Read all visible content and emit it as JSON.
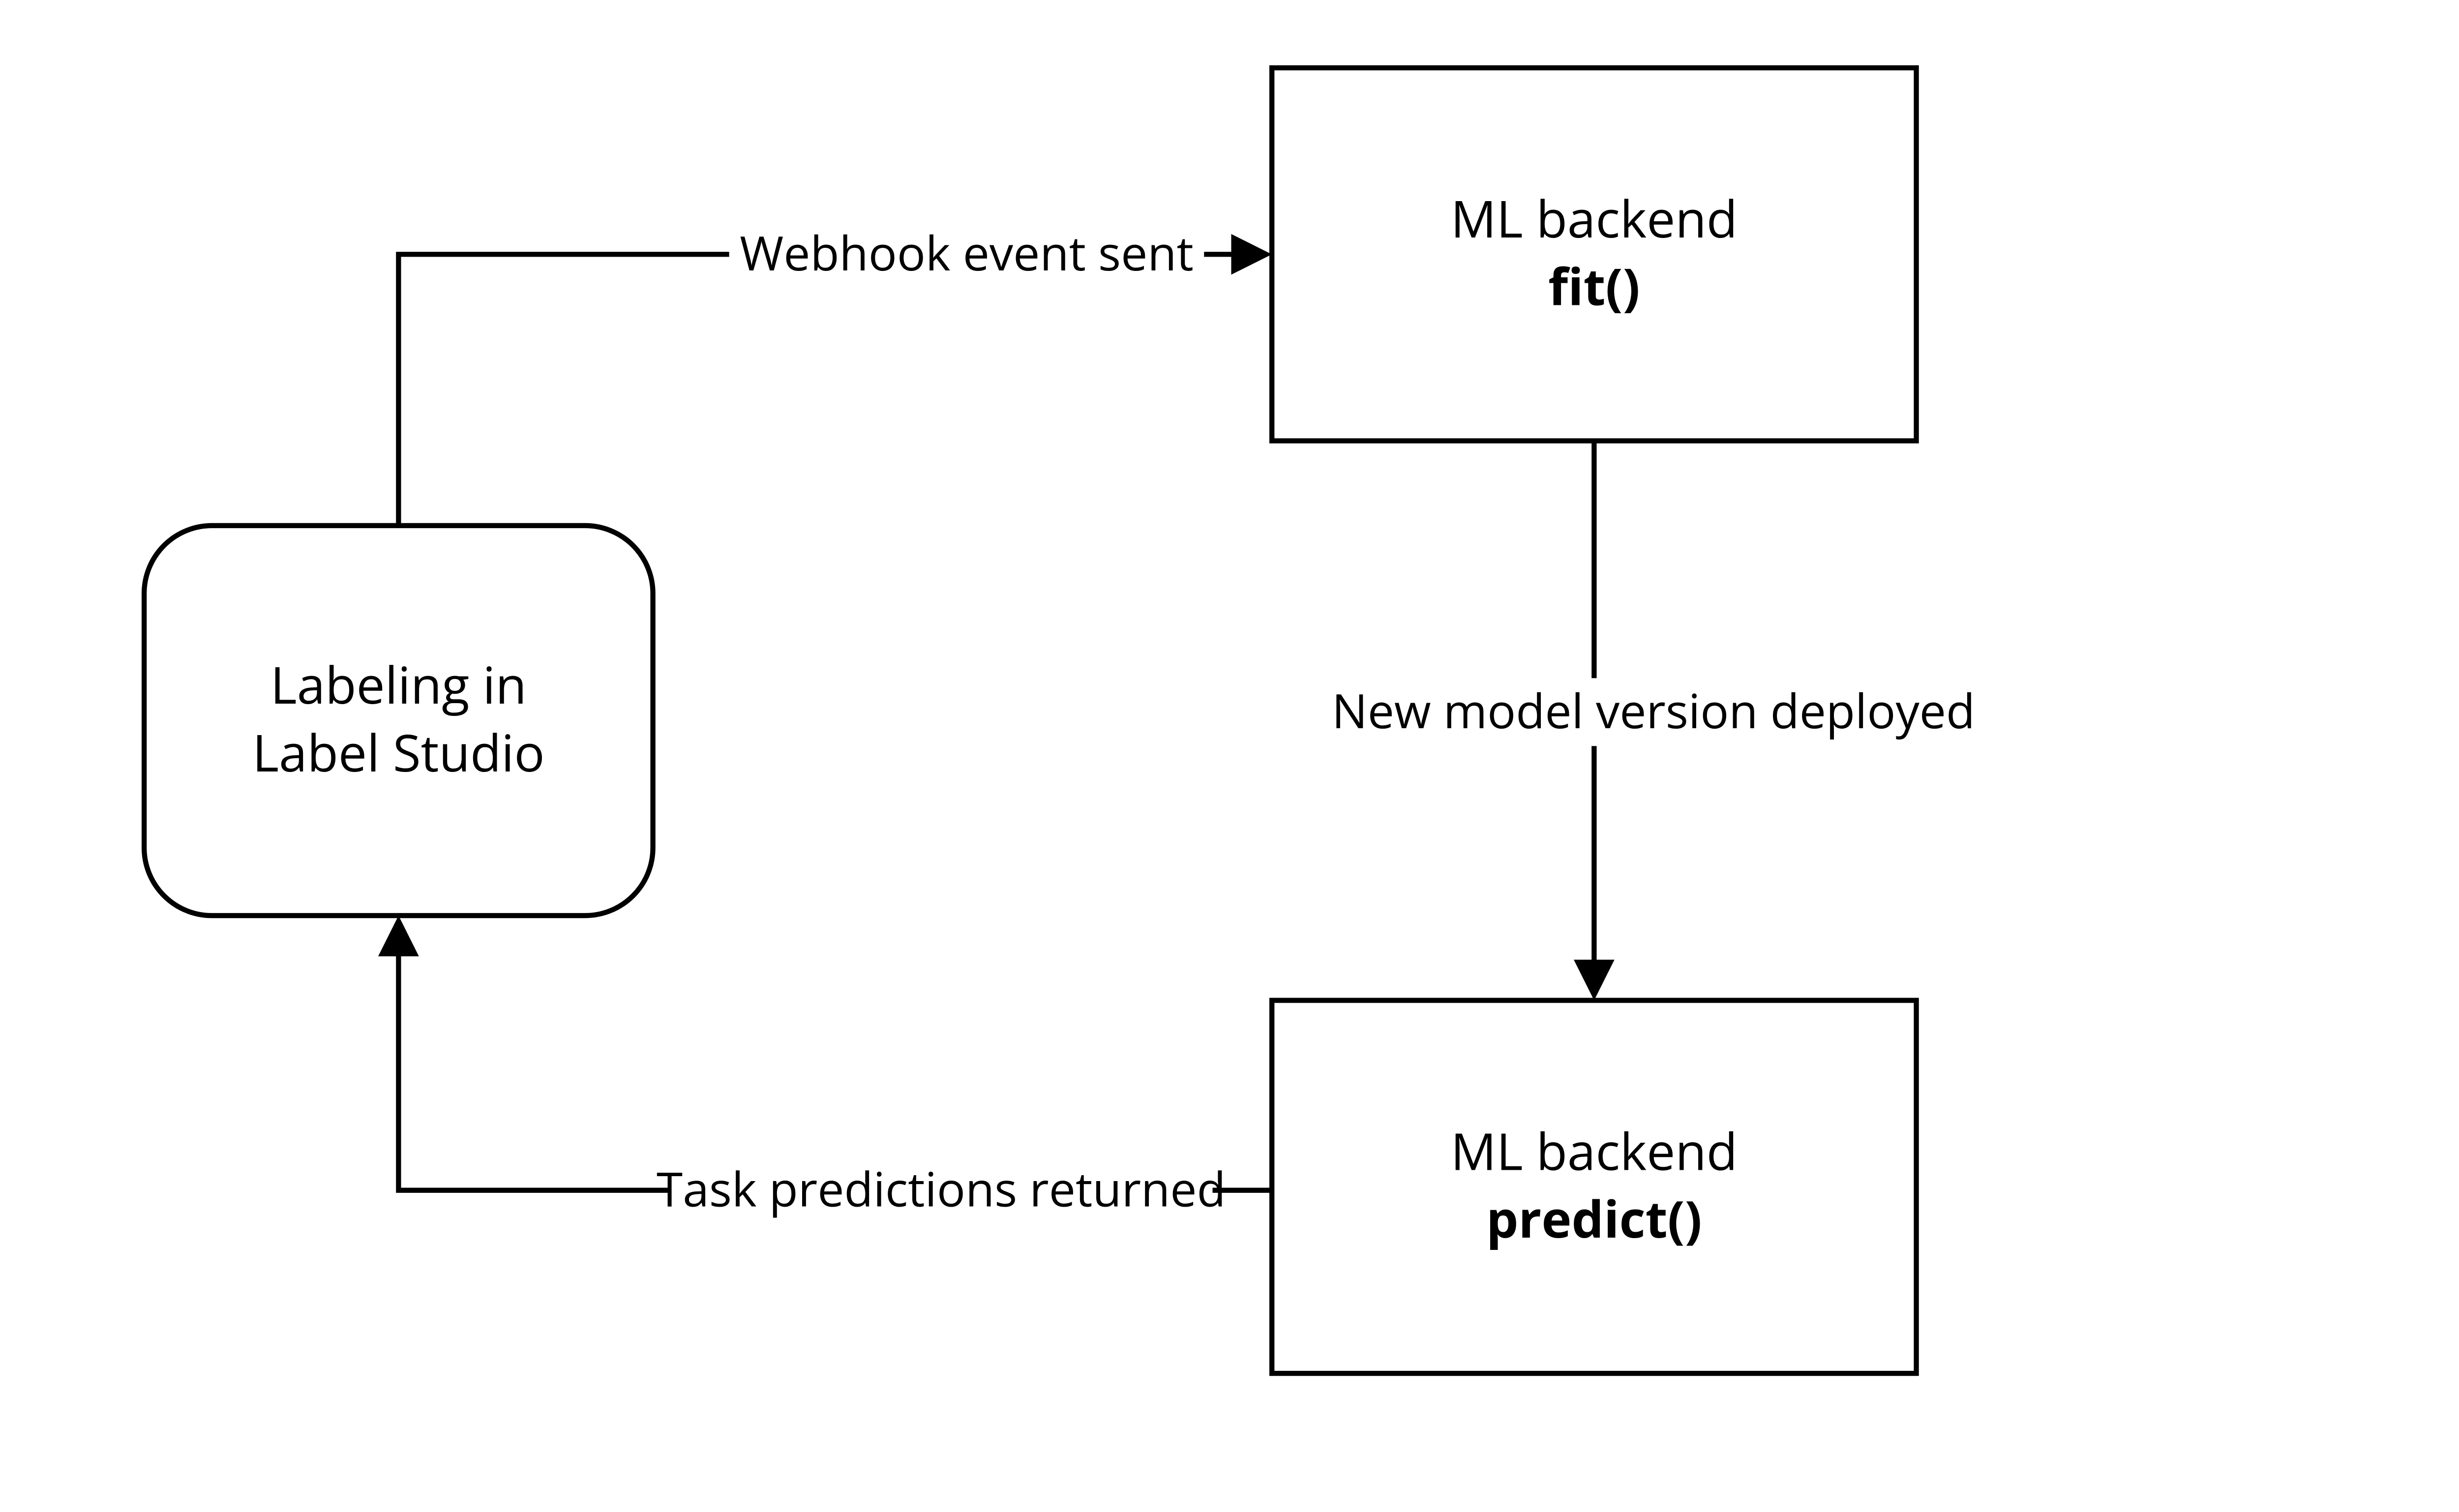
{
  "diagram": {
    "nodes": {
      "label_studio": {
        "line1": "Labeling in",
        "line2": "Label Studio",
        "fill": "#EC8637"
      },
      "fit": {
        "line1": "ML backend",
        "line2": "fit()"
      },
      "predict": {
        "line1": "ML backend",
        "line2": "predict()"
      }
    },
    "edges": {
      "webhook": "Webhook event sent",
      "deploy": "New model version deployed",
      "predictions": "Task predictions returned"
    }
  }
}
